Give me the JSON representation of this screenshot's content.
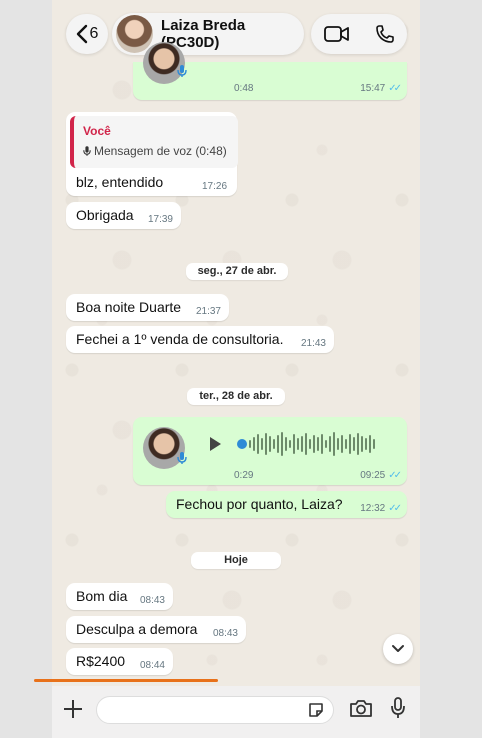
{
  "header": {
    "back_count": "6",
    "contact_name": "Laiza Breda (PC30D)",
    "icons": [
      "chevron-left-icon",
      "video-call-icon",
      "phone-icon"
    ]
  },
  "messages": {
    "voice1": {
      "duration": "0:48",
      "time": "15:47"
    },
    "reply": {
      "author": "Você",
      "quoted": "Mensagem de voz (0:48)",
      "text": "blz, entendido",
      "time": "17:26"
    },
    "m_obrigada": {
      "text": "Obrigada",
      "time": "17:39"
    },
    "date1": "seg., 27 de abr.",
    "m_boanoite": {
      "text": "Boa noite Duarte",
      "time": "21:37"
    },
    "m_fechei": {
      "text": "Fechei a 1º venda de consultoria.",
      "time": "21:43"
    },
    "date2": "ter., 28 de abr.",
    "voice2": {
      "duration": "0:29",
      "time": "09:25"
    },
    "m_fechou": {
      "text": "Fechou por quanto, Laiza?",
      "time": "12:32"
    },
    "date3": "Hoje",
    "m_bomdia": {
      "text": "Bom dia",
      "time": "08:43"
    },
    "m_desculpa": {
      "text": "Desculpa a demora",
      "time": "08:43"
    },
    "m_valor": {
      "text": "R$2400",
      "time": "08:44"
    }
  },
  "colors": {
    "outgoing_bubble": "#d9fdd3",
    "incoming_bubble": "#ffffff",
    "read_ticks": "#53bdeb",
    "reply_accent": "#d1254a",
    "highlight_underline": "#e8711a"
  }
}
